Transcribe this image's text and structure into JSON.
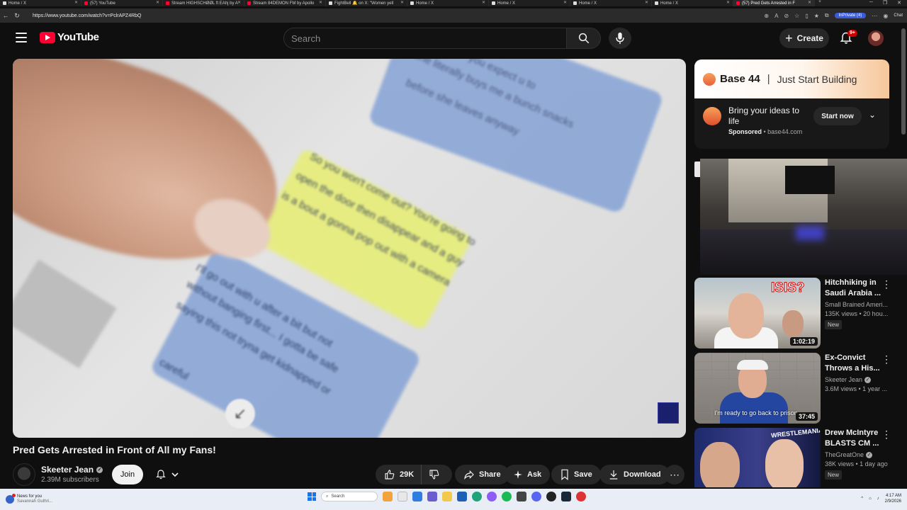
{
  "browser": {
    "tabs": [
      {
        "title": "Home / X",
        "icon": "x-icon",
        "active": false
      },
      {
        "title": "(57) YouTube",
        "icon": "youtube-icon",
        "active": false
      },
      {
        "title": "Stream HIGHSCHØØL ft EAhj by A",
        "icon": "youtube-icon",
        "active": false
      },
      {
        "title": "Stream 84DEMON FM by Apollo",
        "icon": "youtube-icon",
        "active": false
      },
      {
        "title": "FightBell 🔔 on X: \"Women yell",
        "icon": "x-icon",
        "active": false
      },
      {
        "title": "Home / X",
        "icon": "x-icon",
        "active": false
      },
      {
        "title": "Home / X",
        "icon": "x-icon",
        "active": false
      },
      {
        "title": "Home / X",
        "icon": "x-icon",
        "active": false
      },
      {
        "title": "Home / X",
        "icon": "x-icon",
        "active": false
      },
      {
        "title": "(57) Pred Gets Arrested in F",
        "icon": "youtube-icon",
        "active": true
      }
    ],
    "url": "https://www.youtube.com/watch?v=PclrAPZ4RbQ",
    "inprivate_label": "InPrivate (4)",
    "chat_label": "Chat"
  },
  "header": {
    "logo_text": "YouTube",
    "search_placeholder": "Search",
    "create_label": "Create",
    "notification_count": "9+"
  },
  "video": {
    "title": "Pred Gets Arrested in Front of All my Fans!",
    "overlay_text": [
      "you expect u to",
      "She literally buys me a bunch snacks",
      "before she leaves anyway",
      "So you won't come out? You're going to",
      "open the door then disappear and a guy",
      "is a bout a gonna pop out with a camera",
      "I'll go out with u after a bit but not",
      "without banging first... I gotta be safe",
      "saying this not tryna get kidnapped or",
      "careful"
    ]
  },
  "channel": {
    "name": "Skeeter Jean",
    "subscribers": "2.39M subscribers",
    "join_label": "Join"
  },
  "actions": {
    "like_count": "29K",
    "share_label": "Share",
    "ask_label": "Ask",
    "save_label": "Save",
    "download_label": "Download"
  },
  "ad": {
    "brand": "Base 44",
    "tagline": "Just Start Building",
    "headline": "Bring your ideas to life",
    "sponsored": "Sponsored",
    "domain": "base44.com",
    "cta": "Start now"
  },
  "suggestions": [
    {
      "title": "Hitchhiking in Saudi Arabia ...",
      "channel": "Small Brained Ameri...",
      "meta": "135K views • 20 hou...",
      "duration": "1:02:19",
      "badge": "New",
      "thumb_text": "ISIS?",
      "verified": false
    },
    {
      "title": "Ex-Convict Throws a His...",
      "channel": "Skeeter Jean",
      "meta": "3.6M views • 1 year ...",
      "duration": "37:45",
      "badge": "",
      "thumb_text": "I'm ready to go back to prison",
      "verified": true
    },
    {
      "title": "Drew McIntyre BLASTS CM ...",
      "channel": "TheGreatOne",
      "meta": "38K views • 1 day ago",
      "duration": "",
      "badge": "New",
      "thumb_text": "WRESTLEMANIA",
      "verified": true
    }
  ],
  "taskbar": {
    "news_title": "News for you",
    "news_sub": "Savannah Guthri...",
    "search_label": "Search",
    "time": "4:17 AM",
    "date": "2/9/2026"
  }
}
